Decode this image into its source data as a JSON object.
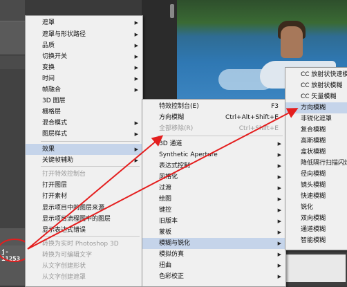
{
  "layer_name": "j-11253",
  "accent_red": "#e41e1e",
  "highlight": "#c5d4ea",
  "main_menu": [
    {
      "label": "遮罩",
      "arrow": true
    },
    {
      "label": "遮罩与形状路径",
      "arrow": true
    },
    {
      "label": "品质",
      "arrow": true
    },
    {
      "label": "切换开关",
      "arrow": true
    },
    {
      "label": "变换",
      "arrow": true
    },
    {
      "label": "时间",
      "arrow": true
    },
    {
      "label": "帧融合",
      "arrow": true
    },
    {
      "label": "3D 图层",
      "arrow": false
    },
    {
      "label": "栅格层",
      "arrow": false
    },
    {
      "label": "混合模式",
      "arrow": true
    },
    {
      "label": "图层样式",
      "arrow": true
    },
    {
      "label": "效果",
      "arrow": true
    },
    {
      "label": "关键帧辅助",
      "arrow": true
    },
    {
      "label": "打开特效控制台",
      "arrow": false
    },
    {
      "label": "打开图层",
      "arrow": false
    },
    {
      "label": "打开素材",
      "arrow": false
    },
    {
      "label": "显示项目中的图层来源",
      "arrow": false
    },
    {
      "label": "显示项目流程图中的图层",
      "arrow": false
    },
    {
      "label": "显示表达式错误",
      "arrow": false
    },
    {
      "label": "转换为实时 Photoshop 3D",
      "arrow": false
    },
    {
      "label": "转换为可编辑文字",
      "arrow": false
    },
    {
      "label": "从文字创建形状",
      "arrow": false
    },
    {
      "label": "从文字创建遮罩",
      "arrow": false
    }
  ],
  "effects_menu": [
    {
      "label": "特效控制台(E)",
      "shortcut": "F3"
    },
    {
      "label": "方向模糊",
      "shortcut": "Ctrl+Alt+Shift+E"
    },
    {
      "label": "全部移除(R)",
      "shortcut": "Ctrl+Shift+E"
    },
    {
      "label": "3D 通道",
      "shortcut": ""
    },
    {
      "label": "Synthetic Aperture",
      "shortcut": ""
    },
    {
      "label": "表达式控制",
      "shortcut": ""
    },
    {
      "label": "风格化",
      "shortcut": ""
    },
    {
      "label": "过渡",
      "shortcut": ""
    },
    {
      "label": "绘图",
      "shortcut": ""
    },
    {
      "label": "键控",
      "shortcut": ""
    },
    {
      "label": "旧版本",
      "shortcut": ""
    },
    {
      "label": "蒙板",
      "shortcut": ""
    },
    {
      "label": "模糊与锐化",
      "shortcut": ""
    },
    {
      "label": "模拟仿真",
      "shortcut": ""
    },
    {
      "label": "扭曲",
      "shortcut": ""
    },
    {
      "label": "色彩校正",
      "shortcut": ""
    }
  ],
  "blur_menu": [
    "CC 放射状快速模糊",
    "CC 放射状模糊",
    "CC 矢量模糊",
    "方向模糊",
    "非锐化遮罩",
    "复合模糊",
    "高斯模糊",
    "盒状模糊",
    "降低隔行扫描闪烁",
    "径向模糊",
    "镜头模糊",
    "快速模糊",
    "锐化",
    "双向模糊",
    "通道模糊",
    "智能模糊"
  ]
}
